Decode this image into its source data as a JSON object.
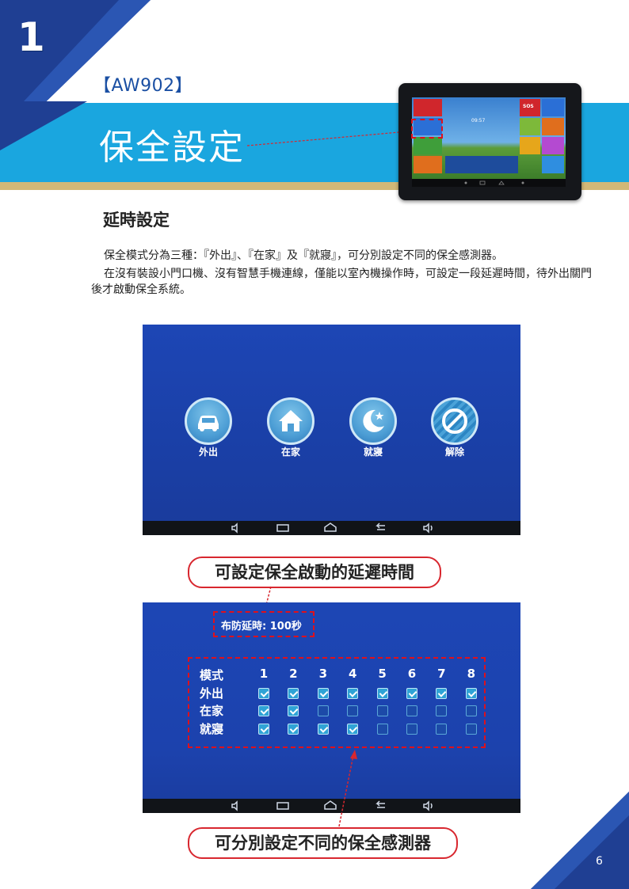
{
  "chapter_number": "1",
  "model_tag": "【AW902】",
  "page_title": "保全設定",
  "tablet": {
    "time": "09:57",
    "sos": "SOS"
  },
  "section_heading": "延時設定",
  "paragraphs": [
    "保全模式分為三種：『外出』、『在家』及『就寢』，可分別設定不同的保全感測器。",
    "在沒有裝設小門口機、沒有智慧手機連線，僅能以室內機操作時，可設定一段延遲時間，待外出關門後才啟動保全系統。"
  ],
  "screen1": {
    "modes": [
      {
        "label": "外出",
        "icon": "car-icon"
      },
      {
        "label": "在家",
        "icon": "house-icon"
      },
      {
        "label": "就寢",
        "icon": "moon-icon"
      },
      {
        "label": "解除",
        "icon": "disarm-icon"
      }
    ]
  },
  "callouts": {
    "delay": "可設定保全啟動的延遲時間",
    "sensors": "可分別設定不同的保全感測器"
  },
  "screen2": {
    "delay_label": "布防延時:  100秒",
    "grid": {
      "header_label": "模式",
      "columns": [
        "1",
        "2",
        "3",
        "4",
        "5",
        "6",
        "7",
        "8"
      ],
      "rows": [
        {
          "label": "外出",
          "checked": [
            true,
            true,
            true,
            true,
            true,
            true,
            true,
            true
          ]
        },
        {
          "label": "在家",
          "checked": [
            true,
            true,
            false,
            false,
            false,
            false,
            false,
            false
          ]
        },
        {
          "label": "就寢",
          "checked": [
            true,
            true,
            true,
            true,
            false,
            false,
            false,
            false
          ]
        }
      ]
    }
  },
  "page_number": "6",
  "colors": {
    "navy": "#1f3f93",
    "band_blue": "#1aa6df",
    "gold": "#d2b877",
    "screen_blue": "#1d46b5",
    "callout_red": "#d8272f"
  }
}
